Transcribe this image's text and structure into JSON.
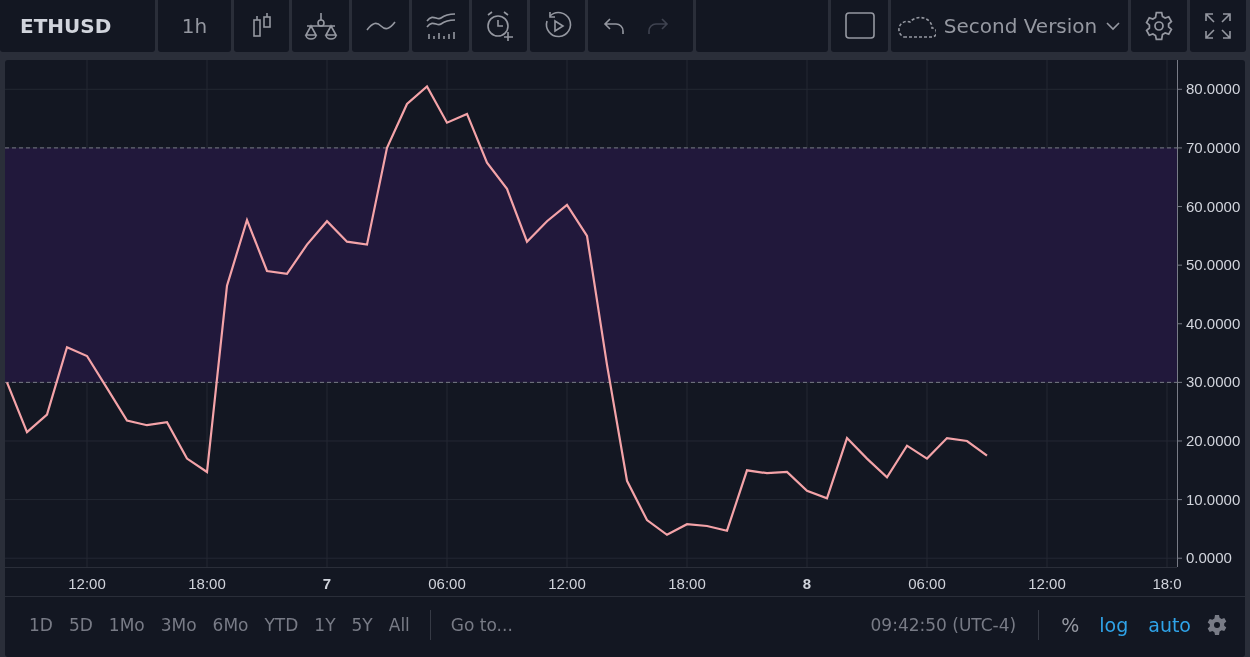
{
  "toolbar": {
    "symbol": "ETHUSD",
    "interval": "1h",
    "tools": [
      {
        "kind": "candles",
        "disabled": false
      },
      {
        "kind": "indicators",
        "disabled": false
      },
      {
        "kind": "line",
        "disabled": false
      },
      {
        "kind": "compare",
        "disabled": false
      },
      {
        "kind": "alert",
        "disabled": false
      },
      {
        "kind": "replay",
        "disabled": false
      },
      {
        "kind": "undo",
        "disabled": false
      },
      {
        "kind": "redo",
        "disabled": true
      }
    ],
    "layout_name": "Second Version"
  },
  "chart": {
    "chart_data": {
      "type": "line",
      "categories": [
        null,
        null,
        null,
        null,
        "12:00",
        null,
        null,
        null,
        null,
        null,
        "18:00",
        null,
        null,
        null,
        null,
        null,
        "7",
        null,
        null,
        null,
        null,
        null,
        "06:00",
        null,
        null,
        null,
        null,
        null,
        "12:00",
        null,
        null,
        null,
        null,
        null,
        "18:00",
        null,
        null,
        null,
        null,
        null,
        "8",
        null,
        null,
        null,
        null,
        null,
        "06:00",
        null,
        null,
        null,
        null,
        null,
        "12:00",
        null,
        null,
        null,
        null,
        null,
        "18:0"
      ],
      "series": [
        {
          "color": "#f4a3a8",
          "values": [
            30,
            21.5,
            24.5,
            36,
            34.5,
            29,
            23.5,
            22.7,
            23.2,
            17,
            14.7,
            46.5,
            57.7,
            49,
            48.5,
            53.5,
            57.5,
            54,
            53.5,
            70,
            77.5,
            80.5,
            74.3,
            75.8,
            67.5,
            63,
            54,
            57.5,
            60.3,
            55,
            33,
            13.2,
            6.5,
            4,
            5.8,
            5.5,
            4.7,
            15,
            14.5,
            14.7,
            11.5,
            10.2,
            20.5,
            17,
            13.8,
            19.2,
            17,
            20.5,
            20,
            17.5,
            null,
            null,
            null,
            null,
            null,
            null,
            null,
            null,
            null
          ]
        }
      ],
      "ylim": [
        -1.5,
        85
      ],
      "yticks": [
        {
          "value": 0,
          "label": "0.0000"
        },
        {
          "value": 10,
          "label": "10.0000"
        },
        {
          "value": 20,
          "label": "20.0000"
        },
        {
          "value": 30,
          "label": "30.0000"
        },
        {
          "value": 40,
          "label": "40.0000"
        },
        {
          "value": 50,
          "label": "50.0000"
        },
        {
          "value": 60,
          "label": "60.0000"
        },
        {
          "value": 70,
          "label": "70.0000"
        },
        {
          "value": 80,
          "label": "80.0000"
        }
      ],
      "bands": [
        {
          "axis": "y",
          "from": 30,
          "to": 70,
          "color": "#21183b"
        }
      ],
      "grid": true
    }
  },
  "bottom_bar": {
    "ranges": [
      "1D",
      "5D",
      "1Mo",
      "3Mo",
      "6Mo",
      "YTD",
      "1Y",
      "5Y",
      "All"
    ],
    "goto": "Go to...",
    "time": "09:42:50 (UTC-4)",
    "toggles": [
      {
        "label": "%",
        "on": false
      },
      {
        "label": "log",
        "on": true
      },
      {
        "label": "auto",
        "on": true
      }
    ]
  }
}
